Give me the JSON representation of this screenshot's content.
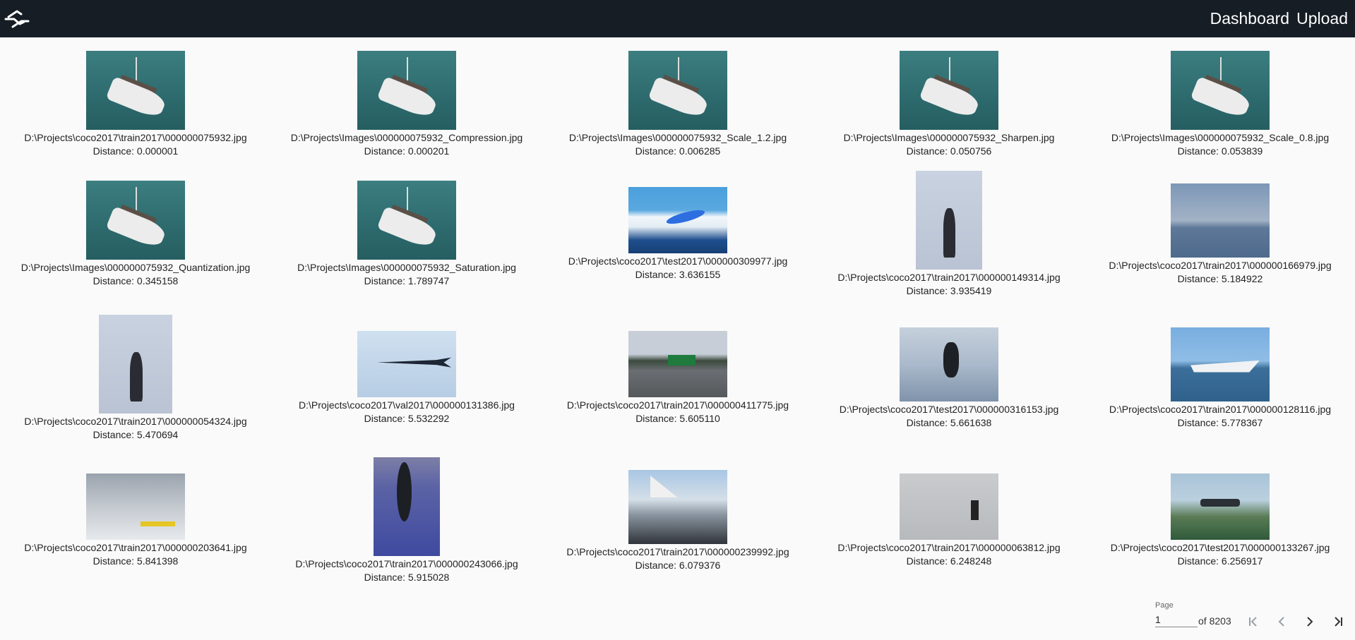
{
  "header": {
    "nav": [
      "Dashboard",
      "Upload"
    ],
    "logo_icon": "swap-logo-icon"
  },
  "results": [
    {
      "path": "D:\\Projects\\coco2017\\train2017\\000000075932.jpg",
      "distance": "Distance: 0.000001"
    },
    {
      "path": "D:\\Projects\\Images\\000000075932_Compression.jpg",
      "distance": "Distance: 0.000201"
    },
    {
      "path": "D:\\Projects\\Images\\000000075932_Scale_1.2.jpg",
      "distance": "Distance: 0.006285"
    },
    {
      "path": "D:\\Projects\\Images\\000000075932_Sharpen.jpg",
      "distance": "Distance: 0.050756"
    },
    {
      "path": "D:\\Projects\\Images\\000000075932_Scale_0.8.jpg",
      "distance": "Distance: 0.053839"
    },
    {
      "path": "D:\\Projects\\Images\\000000075932_Quantization.jpg",
      "distance": "Distance: 0.345158"
    },
    {
      "path": "D:\\Projects\\Images\\000000075932_Saturation.jpg",
      "distance": "Distance: 1.789747"
    },
    {
      "path": "D:\\Projects\\coco2017\\test2017\\000000309977.jpg",
      "distance": "Distance: 3.636155"
    },
    {
      "path": "D:\\Projects\\coco2017\\train2017\\000000149314.jpg",
      "distance": "Distance: 3.935419"
    },
    {
      "path": "D:\\Projects\\coco2017\\train2017\\000000166979.jpg",
      "distance": "Distance: 5.184922"
    },
    {
      "path": "D:\\Projects\\coco2017\\train2017\\000000054324.jpg",
      "distance": "Distance: 5.470694"
    },
    {
      "path": "D:\\Projects\\coco2017\\val2017\\000000131386.jpg",
      "distance": "Distance: 5.532292"
    },
    {
      "path": "D:\\Projects\\coco2017\\train2017\\000000411775.jpg",
      "distance": "Distance: 5.605110"
    },
    {
      "path": "D:\\Projects\\coco2017\\test2017\\000000316153.jpg",
      "distance": "Distance: 5.661638"
    },
    {
      "path": "D:\\Projects\\coco2017\\train2017\\000000128116.jpg",
      "distance": "Distance: 5.778367"
    },
    {
      "path": "D:\\Projects\\coco2017\\train2017\\000000203641.jpg",
      "distance": "Distance: 5.841398"
    },
    {
      "path": "D:\\Projects\\coco2017\\train2017\\000000243066.jpg",
      "distance": "Distance: 5.915028"
    },
    {
      "path": "D:\\Projects\\coco2017\\train2017\\000000239992.jpg",
      "distance": "Distance: 6.079376"
    },
    {
      "path": "D:\\Projects\\coco2017\\train2017\\000000063812.jpg",
      "distance": "Distance: 6.248248"
    },
    {
      "path": "D:\\Projects\\coco2017\\test2017\\000000133267.jpg",
      "distance": "Distance: 6.256917"
    }
  ],
  "pagination": {
    "label": "Page",
    "current": "1",
    "of_text": "of 8203",
    "first_icon": "first-page-icon",
    "prev_icon": "chevron-left-icon",
    "next_icon": "chevron-right-icon",
    "last_icon": "last-page-icon"
  }
}
